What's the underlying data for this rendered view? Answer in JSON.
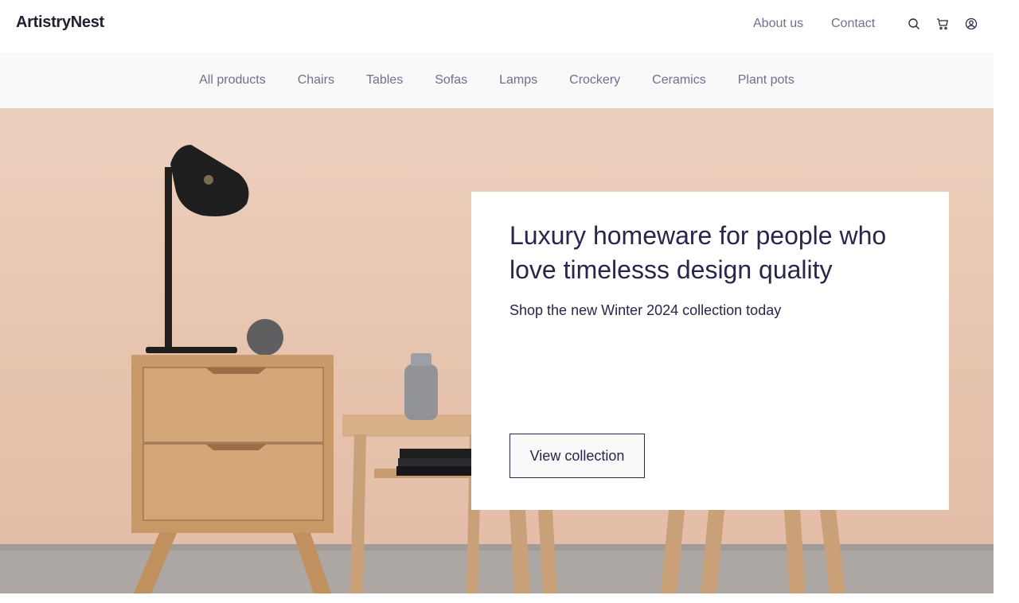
{
  "header": {
    "logo": "ArtistryNest",
    "links": {
      "about": "About us",
      "contact": "Contact"
    },
    "icons": [
      "search-icon",
      "cart-icon",
      "user-icon"
    ]
  },
  "categories": [
    "All products",
    "Chairs",
    "Tables",
    "Sofas",
    "Lamps",
    "Crockery",
    "Ceramics",
    "Plant pots"
  ],
  "hero": {
    "title": "Luxury homeware for people who love timelesss design quality",
    "subtitle": "Shop the new Winter 2024 collection today",
    "cta": "View collection"
  },
  "colors": {
    "brand": "#2a254b",
    "muted": "#726e8d",
    "catbar_bg": "#f9f9f9",
    "hero_bg": "#e7c4af"
  }
}
